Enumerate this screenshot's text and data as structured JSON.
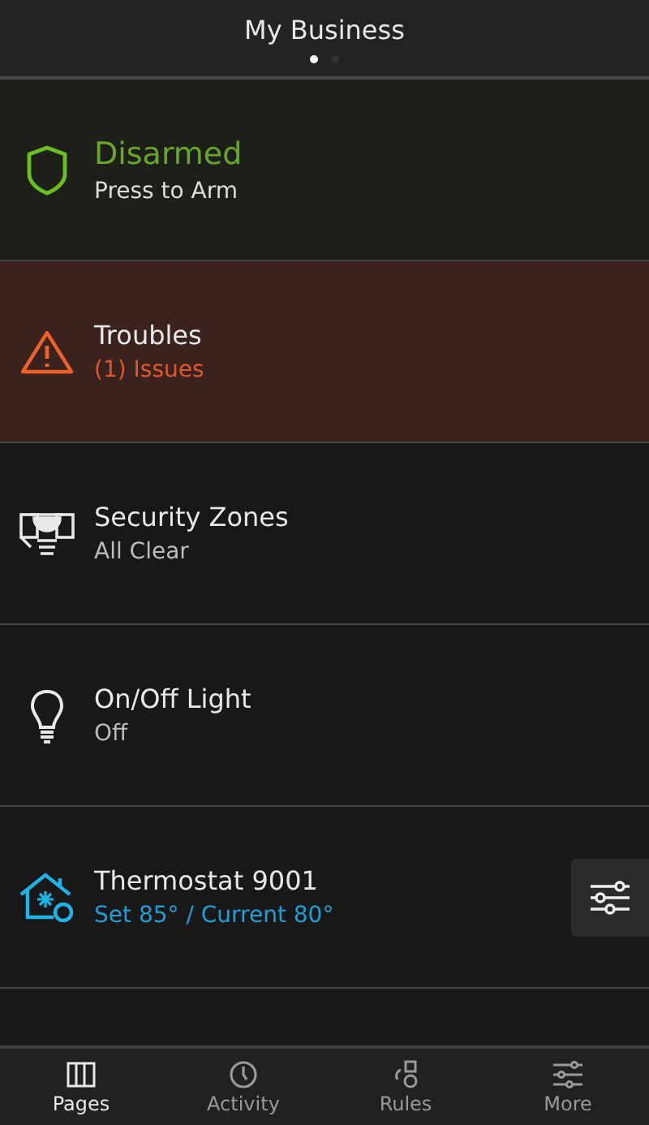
{
  "header": {
    "title": "My Business",
    "page_dots": [
      {
        "selected": true
      },
      {
        "selected": false
      }
    ]
  },
  "rows": [
    {
      "kind": "alarm",
      "title": "Disarmed",
      "subtitle": "Press to Arm"
    },
    {
      "kind": "trouble",
      "title": "Troubles",
      "subtitle": "(1) Issues"
    },
    {
      "kind": "zones",
      "title": "Security Zones",
      "subtitle": "All Clear"
    },
    {
      "kind": "light",
      "title": "On/Off Light",
      "subtitle": "Off"
    },
    {
      "kind": "thermostat",
      "title": "Thermostat 9001",
      "subtitle": "Set 85° / Current 80°",
      "has_controls": true
    }
  ],
  "tabs": [
    {
      "kind": "pages",
      "label": "Pages",
      "selected": true
    },
    {
      "kind": "activity",
      "label": "Activity",
      "selected": false
    },
    {
      "kind": "rules",
      "label": "Rules",
      "selected": false
    },
    {
      "kind": "more",
      "label": "More",
      "selected": false
    }
  ]
}
